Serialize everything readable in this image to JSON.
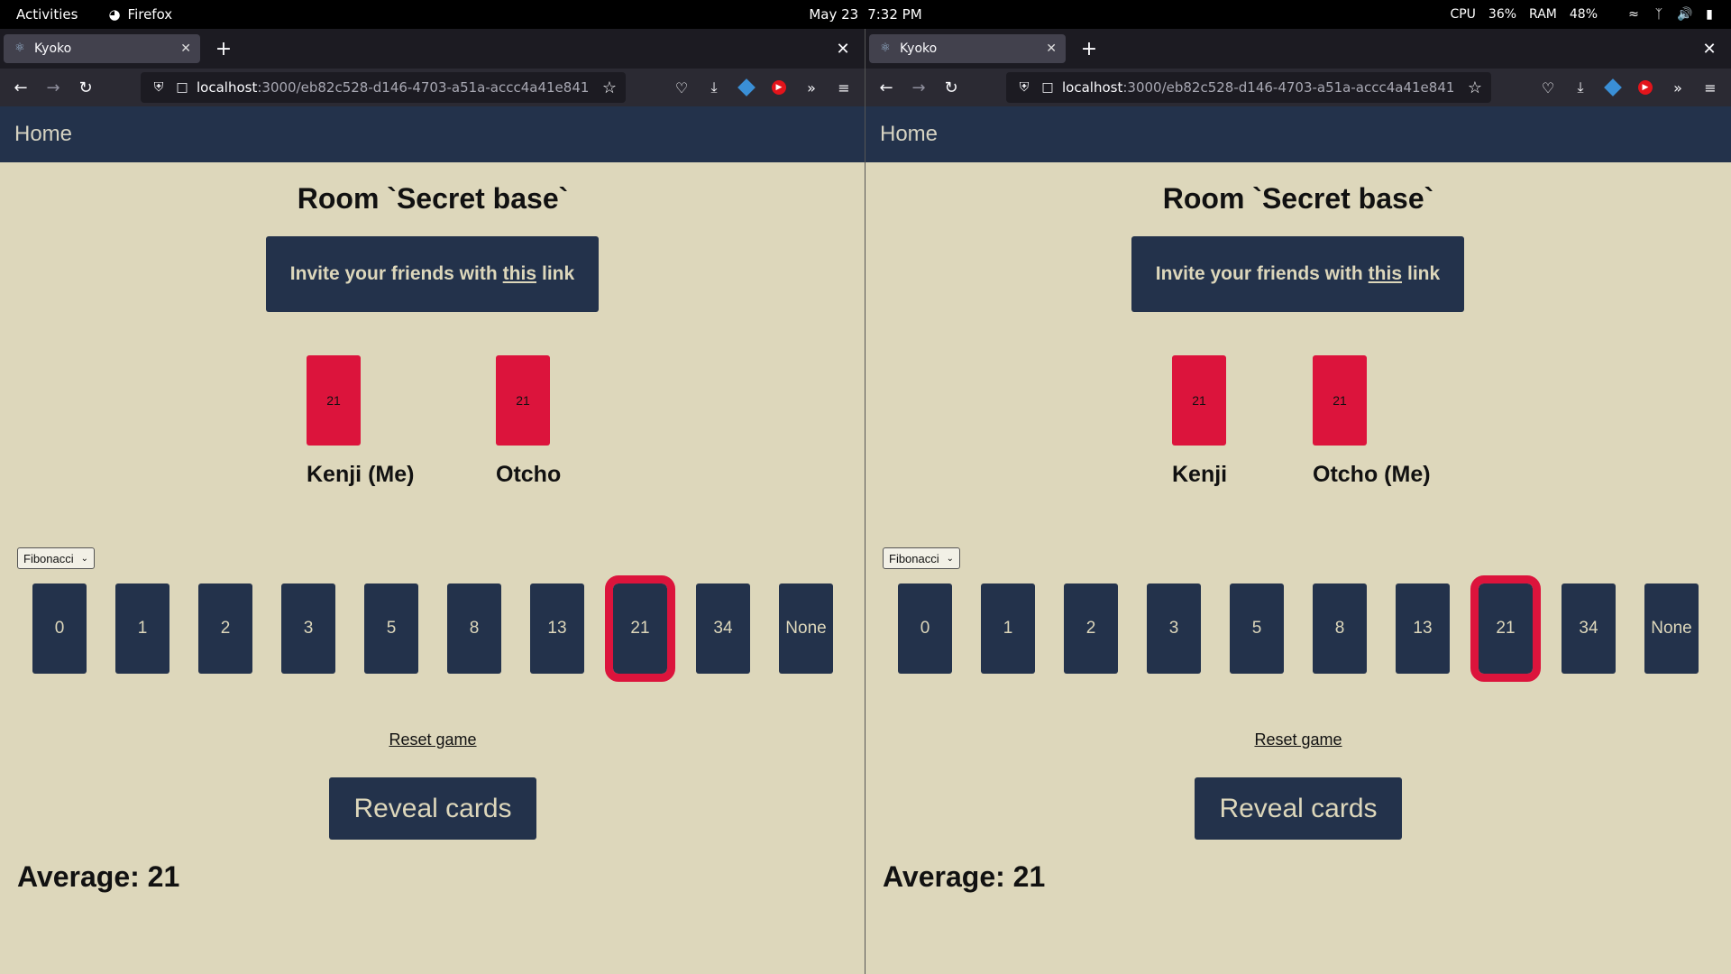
{
  "system": {
    "activities": "Activities",
    "app_name": "Firefox",
    "date": "May 23",
    "time": "7:32 PM",
    "cpu_label": "CPU",
    "cpu_value": "36%",
    "ram_label": "RAM",
    "ram_value": "48%"
  },
  "windows": [
    {
      "tab_title": "Kyoko",
      "url_host": "localhost",
      "url_path": ":3000/eb82c528-d146-4703-a51a-accc4a41e841",
      "home": "Home",
      "room_title": "Room `Secret base`",
      "invite_pre": "Invite your friends with",
      "invite_link": "this",
      "invite_post": "link",
      "players": [
        {
          "name": "Kenji (Me)",
          "card": "21"
        },
        {
          "name": "Otcho",
          "card": "21"
        }
      ],
      "deck": "Fibonacci",
      "cards": [
        "0",
        "1",
        "2",
        "3",
        "5",
        "8",
        "13",
        "21",
        "34",
        "None"
      ],
      "selected_card": "21",
      "reset_label": "Reset game",
      "reveal_label": "Reveal cards",
      "average": "Average: 21"
    },
    {
      "tab_title": "Kyoko",
      "url_host": "localhost",
      "url_path": ":3000/eb82c528-d146-4703-a51a-accc4a41e841",
      "home": "Home",
      "room_title": "Room `Secret base`",
      "invite_pre": "Invite your friends with",
      "invite_link": "this",
      "invite_post": "link",
      "players": [
        {
          "name": "Kenji",
          "card": "21"
        },
        {
          "name": "Otcho (Me)",
          "card": "21"
        }
      ],
      "deck": "Fibonacci",
      "cards": [
        "0",
        "1",
        "2",
        "3",
        "5",
        "8",
        "13",
        "21",
        "34",
        "None"
      ],
      "selected_card": "21",
      "reset_label": "Reset game",
      "reveal_label": "Reveal cards",
      "average": "Average: 21"
    }
  ],
  "colors": {
    "app_background": "#ddd7bb",
    "navy": "#23324b",
    "crimson": "#dc143c"
  }
}
